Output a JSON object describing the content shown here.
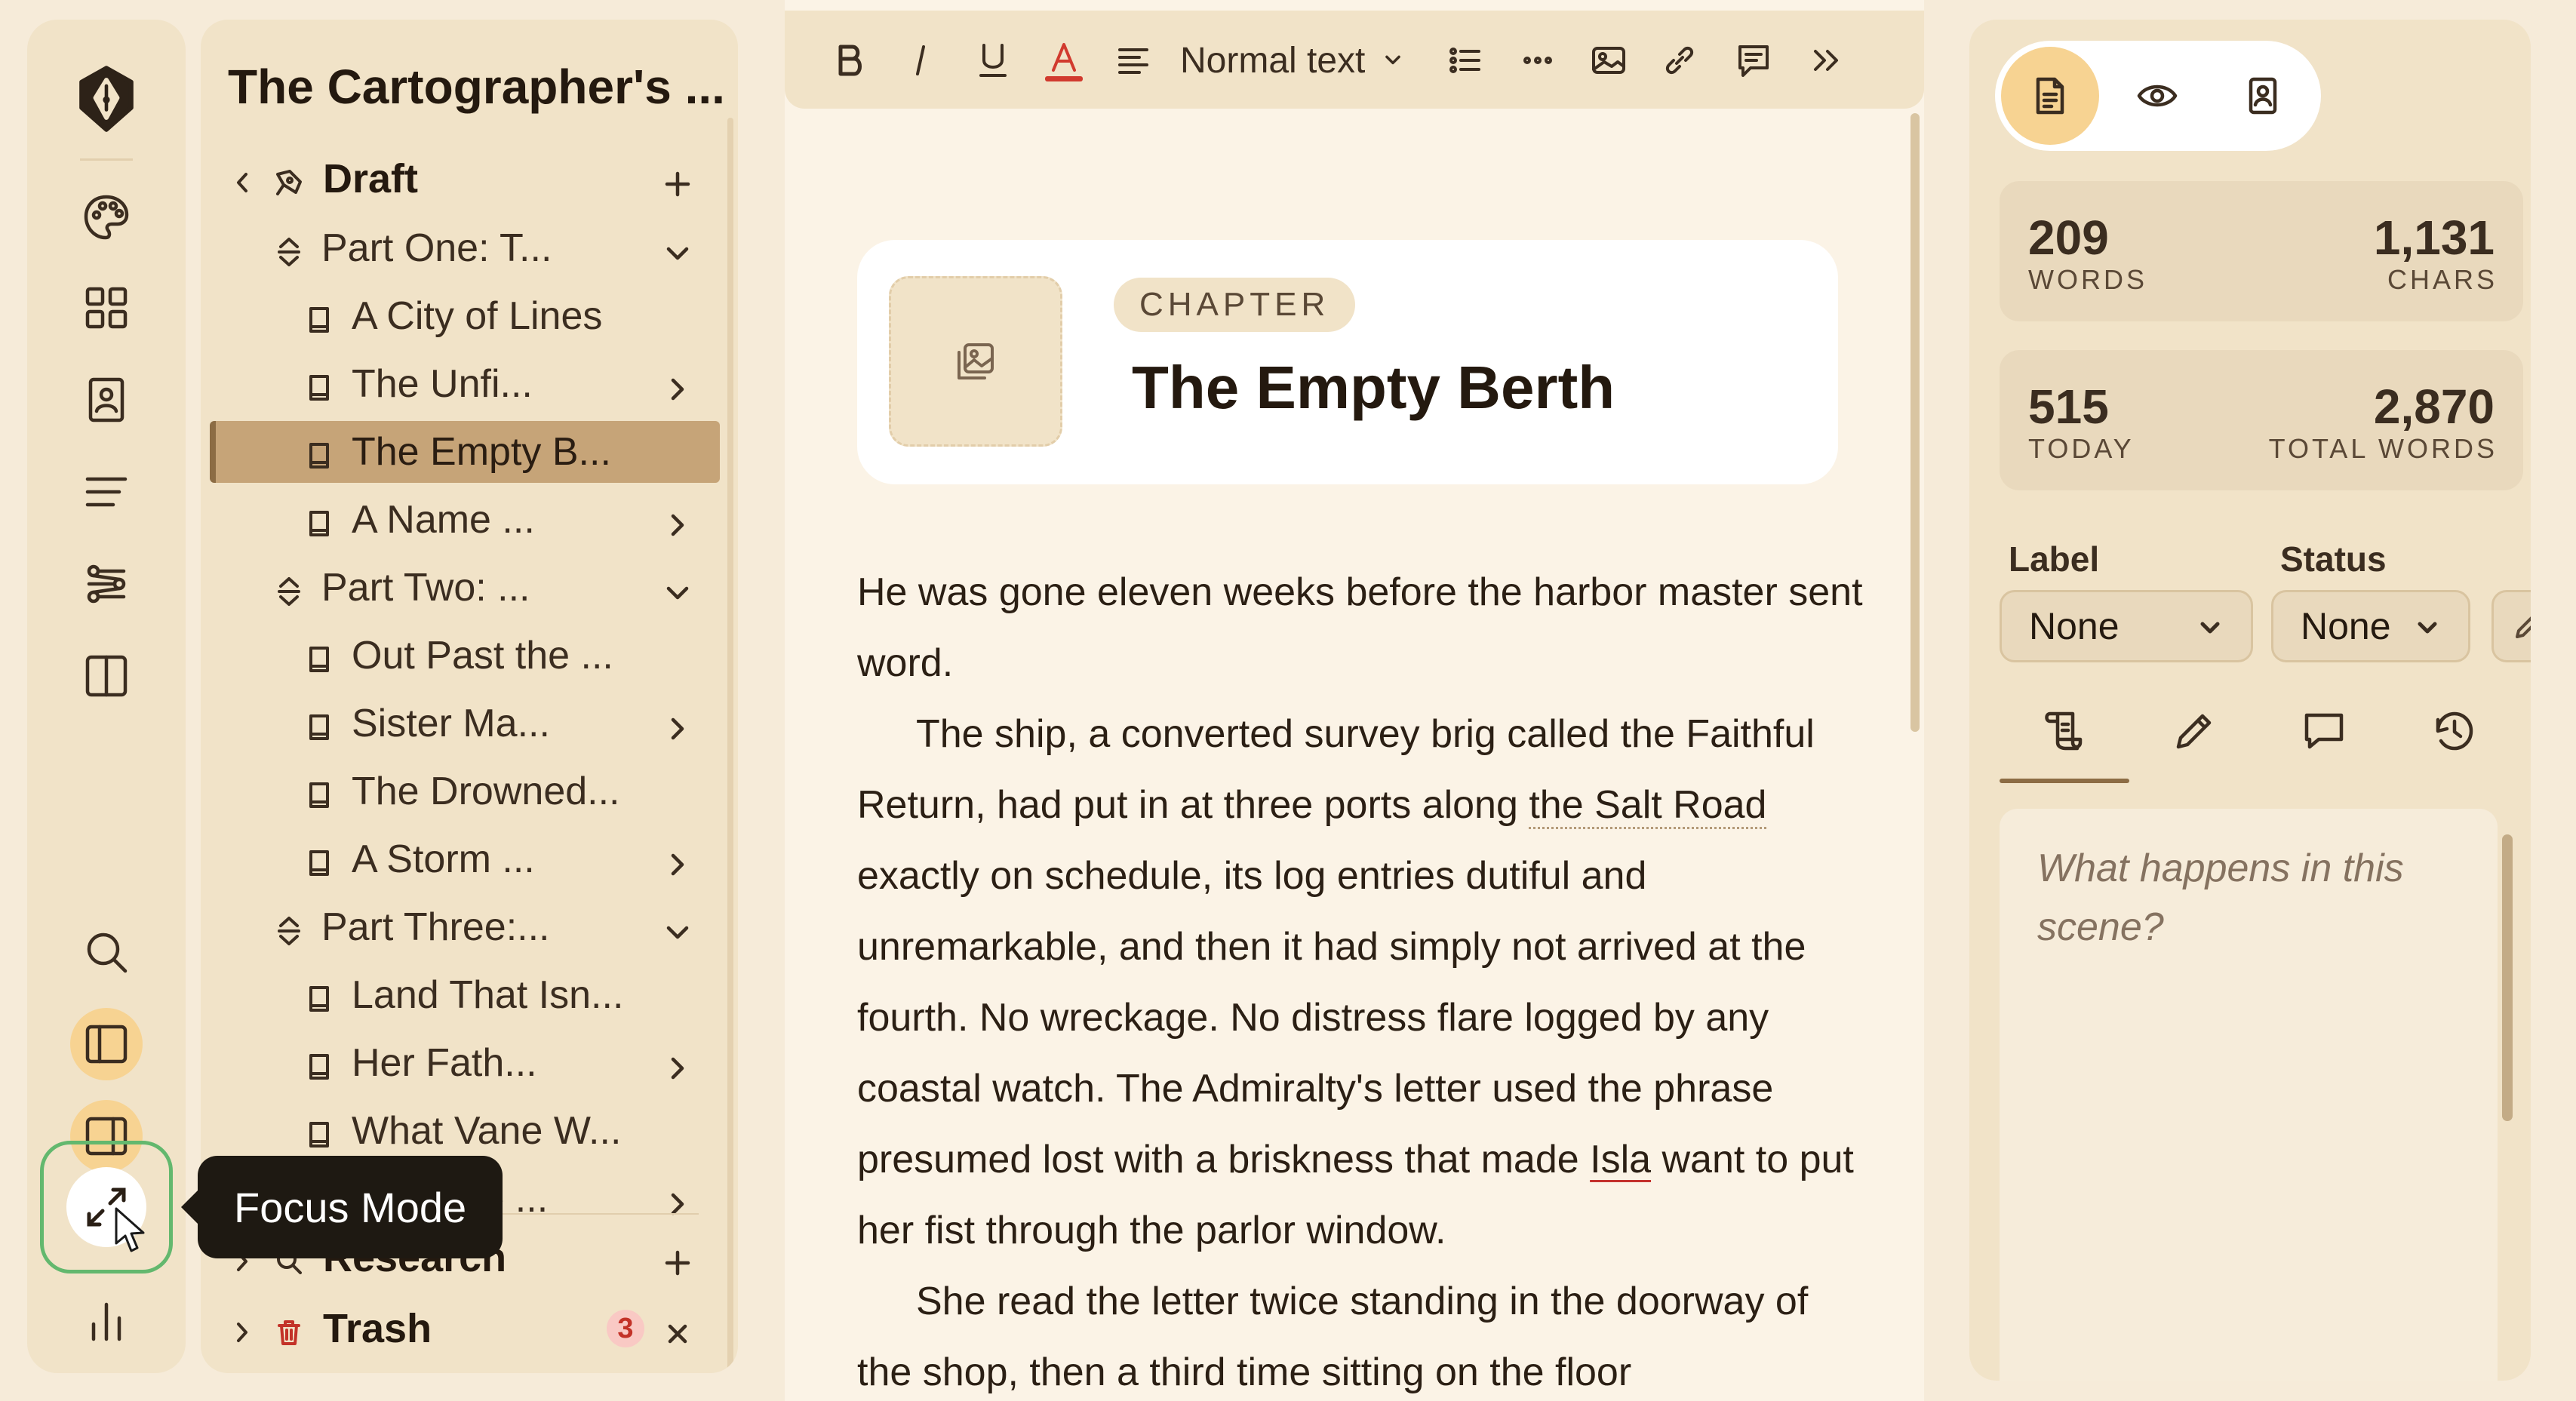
{
  "rail": {
    "icons": [
      "app-logo-icon",
      "palette-icon",
      "grid-icon",
      "contact-card-icon",
      "outline-icon",
      "flow-icon",
      "columns-icon",
      "search-icon",
      "sidebar-left-icon",
      "sidebar-right-icon",
      "focus-mode-icon",
      "stats-icon"
    ],
    "active_icons": [
      "sidebar-left-icon",
      "sidebar-right-icon"
    ],
    "tooltip": "Focus Mode"
  },
  "binder": {
    "title": "The Cartographer's ...",
    "draft_label": "Draft",
    "items": [
      {
        "label": "Part One: T...",
        "type": "part",
        "expanded": true
      },
      {
        "label": "A City of Lines",
        "type": "doc",
        "has_children": false
      },
      {
        "label": "The Unfi...",
        "type": "doc",
        "has_children": true
      },
      {
        "label": "The Empty B...",
        "type": "doc",
        "has_children": false,
        "selected": true
      },
      {
        "label": "A Name ...",
        "type": "doc",
        "has_children": true
      },
      {
        "label": "Part Two: ...",
        "type": "part",
        "expanded": true
      },
      {
        "label": "Out Past the ...",
        "type": "doc",
        "has_children": false
      },
      {
        "label": "Sister Ma...",
        "type": "doc",
        "has_children": true
      },
      {
        "label": "The Drowned...",
        "type": "doc",
        "has_children": false
      },
      {
        "label": "A Storm ...",
        "type": "doc",
        "has_children": true
      },
      {
        "label": "Part Three:...",
        "type": "part",
        "expanded": true
      },
      {
        "label": "Land That Isn...",
        "type": "doc",
        "has_children": false
      },
      {
        "label": "Her Fath...",
        "type": "doc",
        "has_children": true
      },
      {
        "label": "What Vane W...",
        "type": "doc",
        "has_children": false
      },
      {
        "label": "The Line ...",
        "type": "doc",
        "has_children": true
      }
    ],
    "research_label": "Research",
    "trash_label": "Trash",
    "trash_count": "3"
  },
  "toolbar": {
    "style_select": "Normal text",
    "text_color": "#d13a2e"
  },
  "chapter": {
    "tag": "CHAPTER",
    "title": "The Empty Berth"
  },
  "body": {
    "p1": "He was gone eleven weeks before the harbor master sent word.",
    "p2_a": "The ship, a converted survey brig called the Faithful Return, had put in at three ports along ",
    "p2_link": "the Salt Road",
    "p2_b": " exactly on schedule, its log entries dutiful and unremarkable, and then it had simply not arrived at the fourth. No wreckage. No distress flare logged by any coastal watch. The Admiralty's letter used the phrase presumed lost with a briskness that made ",
    "p2_name": "Isla",
    "p2_c": " want to put her fist through the parlor window.",
    "p3": "She read the letter twice standing in the doorway of the shop, then a third time sitting on the floor"
  },
  "inspector": {
    "words": "209",
    "words_label": "WORDS",
    "chars": "1,131",
    "chars_label": "CHARS",
    "today": "515",
    "today_label": "TODAY",
    "total": "2,870",
    "total_label": "TOTAL WORDS",
    "label_title": "Label",
    "label_value": "None",
    "status_title": "Status",
    "status_value": "None",
    "notes_placeholder": "What happens in this scene?"
  },
  "colors": {
    "accent": "#f7d392",
    "selected_row": "#c6a478",
    "focus_ring": "#63b86e",
    "badge_text": "#c33228"
  }
}
